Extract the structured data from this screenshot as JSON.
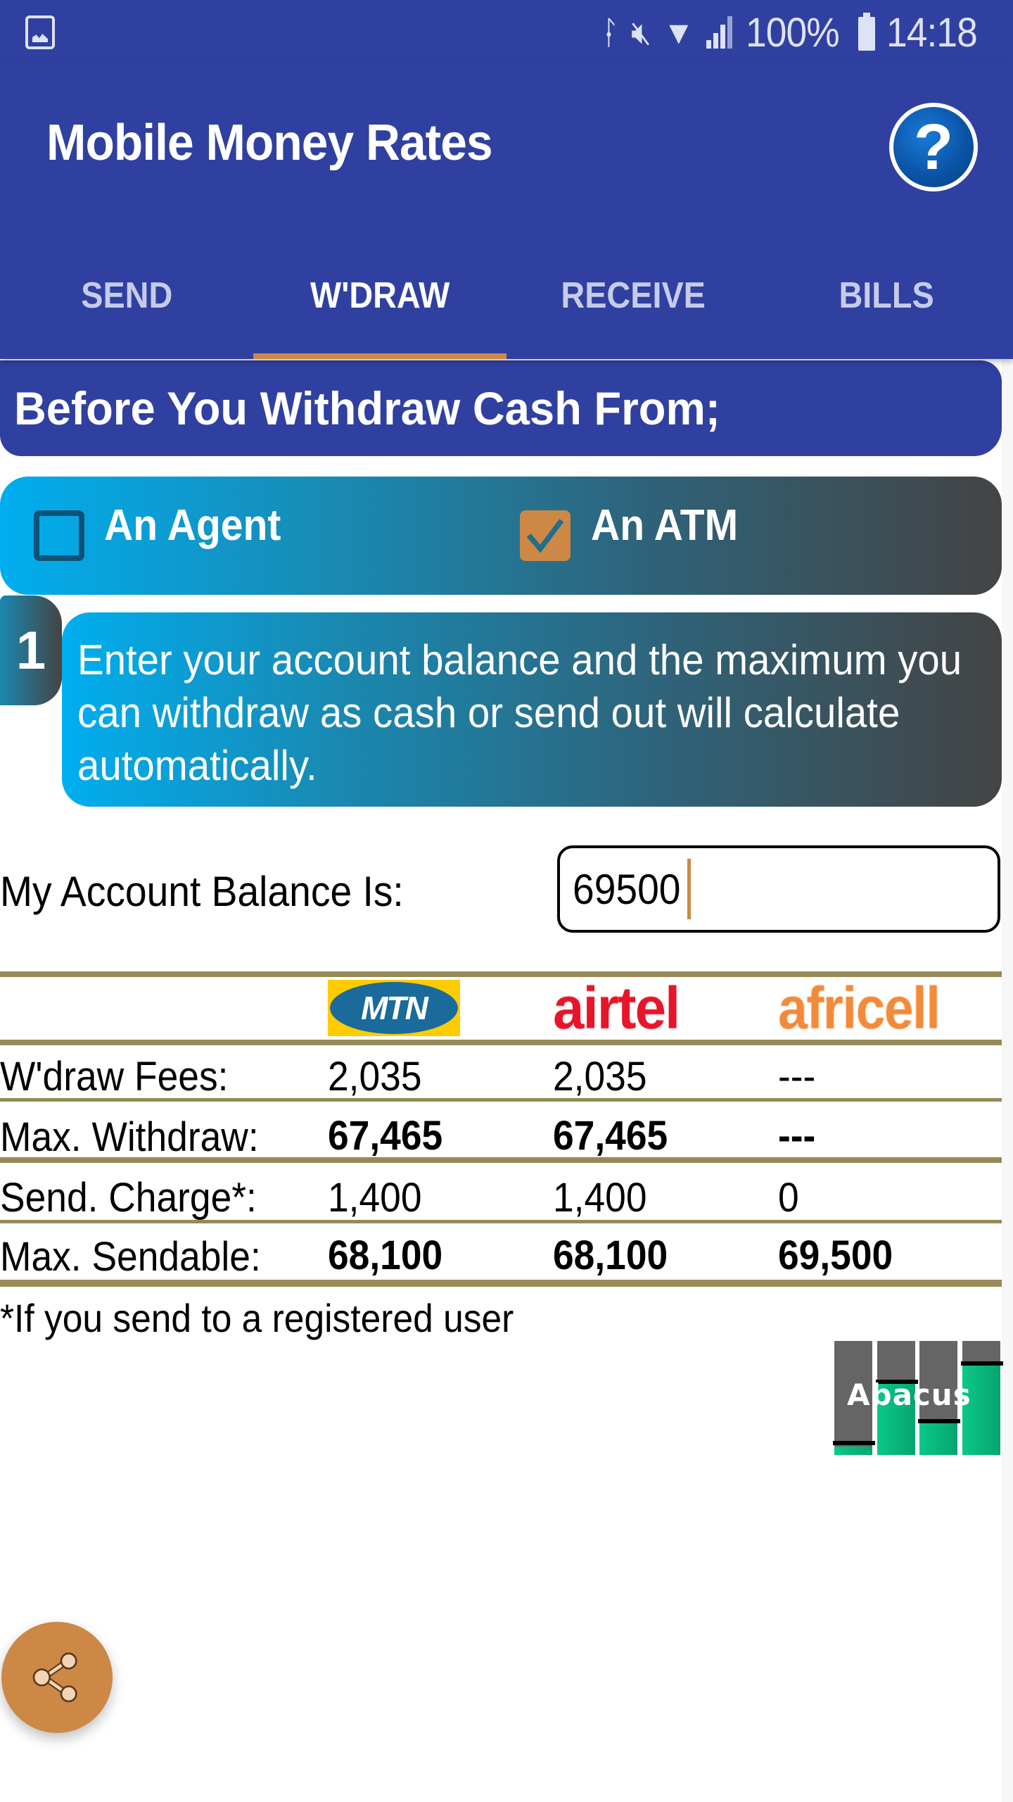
{
  "status_bar": {
    "left_icon": "gallery-icon",
    "icons": [
      "bluetooth-icon",
      "mute-icon",
      "wifi-icon",
      "signal-icon"
    ],
    "battery_percent": "100%",
    "battery_icon": "battery-icon",
    "time": "14:18"
  },
  "app_bar": {
    "title": "Mobile Money Rates",
    "help_icon": "help-icon",
    "help_glyph": "?"
  },
  "tabs": [
    {
      "label": "SEND",
      "active": false
    },
    {
      "label": "W'DRAW",
      "active": true
    },
    {
      "label": "RECEIVE",
      "active": false
    },
    {
      "label": "BILLS",
      "active": false
    }
  ],
  "banner": {
    "text": "Before You Withdraw Cash From;"
  },
  "options": {
    "agent": {
      "label": "An Agent",
      "checked": false
    },
    "atm": {
      "label": "An ATM",
      "checked": true
    }
  },
  "step": {
    "number": "1",
    "text": "Enter your account balance and the maximum you can withdraw as cash or send out will calculate automatically."
  },
  "balance": {
    "label": "My Account Balance Is:",
    "value": "69500"
  },
  "rates_table": {
    "providers": [
      "MTN",
      "airtel",
      "africell"
    ],
    "rows": [
      {
        "label": "W'draw Fees:",
        "values": [
          "2,035",
          "2,035",
          "---"
        ],
        "bold": false
      },
      {
        "label": "Max. Withdraw:",
        "values": [
          "67,465",
          "67,465",
          "---"
        ],
        "bold": true
      },
      {
        "label": "Send. Charge*:",
        "values": [
          "1,400",
          "1,400",
          "0"
        ],
        "bold": false
      },
      {
        "label": "Max. Sendable:",
        "values": [
          "68,100",
          "68,100",
          "69,500"
        ],
        "bold": true
      }
    ]
  },
  "footnote": "*If you send to a registered user",
  "brand_logo": {
    "text": "Abacus"
  },
  "fab": {
    "icon": "share-icon"
  },
  "colors": {
    "primary": "#3040a0",
    "accent": "#cc8844",
    "table_rule": "#978a58",
    "gradient_start": "#00aeef",
    "gradient_end": "#444444"
  }
}
